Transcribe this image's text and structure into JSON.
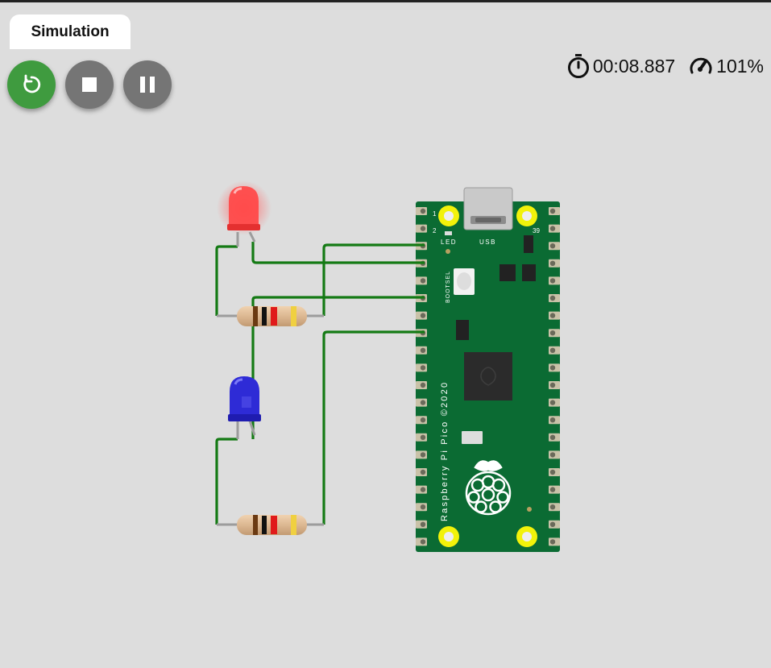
{
  "tab": {
    "label": "Simulation"
  },
  "controls": {
    "restart_icon": "restart-icon",
    "stop_icon": "stop-icon",
    "pause_icon": "pause-icon"
  },
  "status": {
    "timer_icon": "stopwatch-icon",
    "elapsed": "00:08.887",
    "speed_icon": "speedometer-icon",
    "speed": "101%"
  },
  "board": {
    "label_led": "LED",
    "label_usb": "USB",
    "label_bootsel": "BOOTSEL",
    "pin_1": "1",
    "pin_2": "2",
    "pin_39": "39",
    "name": "Raspberry Pi Pico ©2020",
    "color": "#0b6b33"
  },
  "components": {
    "led_red": {
      "state": "on",
      "color": "#ff3b3b"
    },
    "led_blue": {
      "state": "off",
      "color": "#2e2bd6"
    },
    "resistor_1": {
      "bands": [
        "#6b3a12",
        "#111111",
        "#e01a1a",
        "#f0d040"
      ]
    },
    "resistor_2": {
      "bands": [
        "#6b3a12",
        "#111111",
        "#e01a1a",
        "#f0d040"
      ]
    }
  },
  "colors": {
    "accent_green": "#3f9b3f",
    "control_gray": "#757575",
    "wire_green": "#147a14",
    "background": "#dddddd"
  }
}
